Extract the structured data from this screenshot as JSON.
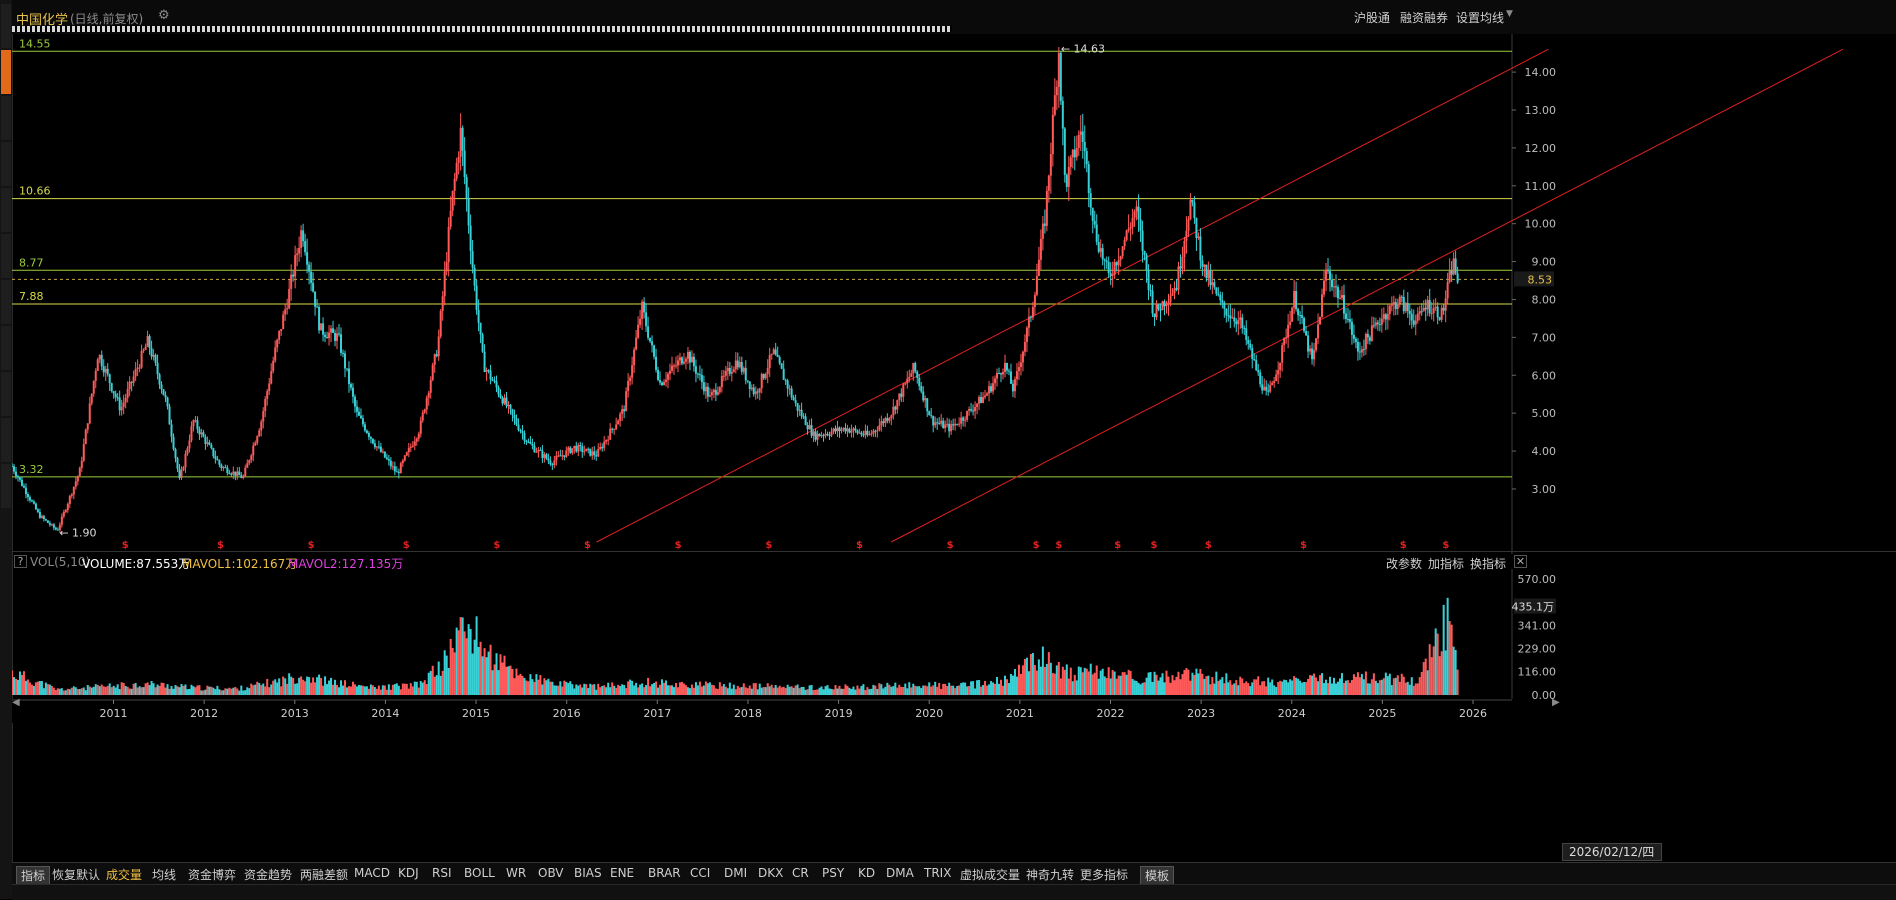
{
  "header": {
    "title": "中国化学",
    "subtitle": "(日线,前复权)",
    "menu": [
      "沪股通",
      "融资融券",
      "设置均线"
    ]
  },
  "volume_panel": {
    "label": "VOL(5,10)",
    "volume": "VOLUME:87.553万",
    "mavol1": "MAVOL1:102.167万",
    "mavol2": "MAVOL2:127.135万",
    "buttons": [
      "改参数",
      "加指标",
      "换指标"
    ],
    "current_label": "435.1万"
  },
  "date_box": "2026/02/12/四",
  "bottom_tabs": [
    "指标",
    "恢复默认",
    "成交量",
    "均线",
    "资金博弈",
    "资金趋势",
    "两融差额",
    "MACD",
    "KDJ",
    "RSI",
    "BOLL",
    "WR",
    "OBV",
    "BIAS",
    "ENE",
    "BRAR",
    "CCI",
    "DMI",
    "DKX",
    "CR",
    "PSY",
    "KD",
    "DMA",
    "TRIX",
    "虚拟成交量",
    "神奇九转",
    "更多指标",
    "模板"
  ],
  "colors": {
    "up": "#ff5a5a",
    "down": "#39d0d6",
    "hline_green": "#9ccc3a",
    "hline_yellow": "#d8d84a",
    "trend": "#e02020",
    "price_tag": "#e8c04a",
    "mavol1": "#f0c040",
    "mavol2": "#e040e0"
  },
  "chart_data": [
    {
      "type": "candlestick",
      "title": "中国化学",
      "ylim": [
        1.6,
        14.9
      ],
      "y_ticks": [
        "14.00",
        "13.00",
        "12.00",
        "11.00",
        "10.00",
        "9.00",
        "8.00",
        "7.00",
        "6.00",
        "5.00",
        "4.00",
        "3.00"
      ],
      "x_ticks": [
        "2011",
        "2012",
        "2013",
        "2014",
        "2015",
        "2016",
        "2017",
        "2018",
        "2019",
        "2020",
        "2021",
        "2022",
        "2023",
        "2024",
        "2025",
        "2026"
      ],
      "current_price": "8.53",
      "max_label": "14.63",
      "min_label": "1.90",
      "horizontal_lines": [
        {
          "label": "14.55",
          "value": 14.55,
          "color": "green"
        },
        {
          "label": "10.66",
          "value": 10.66,
          "color": "yellow"
        },
        {
          "label": "8.77",
          "value": 8.77,
          "color": "green"
        },
        {
          "label": "7.88",
          "value": 7.88,
          "color": "yellow"
        },
        {
          "label": "3.32",
          "value": 3.32,
          "color": "green"
        }
      ],
      "trend_lines": [
        {
          "from": [
            2016.45,
            1.6
          ],
          "to": [
            2026.95,
            14.6
          ]
        },
        {
          "from": [
            2019.7,
            1.6
          ],
          "to": [
            2030.2,
            14.6
          ]
        }
      ],
      "price_path": [
        [
          2010.0,
          3.6
        ],
        [
          2010.3,
          2.3
        ],
        [
          2010.5,
          1.9
        ],
        [
          2010.75,
          3.5
        ],
        [
          2010.95,
          6.6
        ],
        [
          2011.2,
          5.1
        ],
        [
          2011.5,
          6.9
        ],
        [
          2011.7,
          5.3
        ],
        [
          2011.85,
          3.2
        ],
        [
          2012.0,
          4.8
        ],
        [
          2012.3,
          3.6
        ],
        [
          2012.55,
          3.3
        ],
        [
          2012.75,
          4.8
        ],
        [
          2012.9,
          6.6
        ],
        [
          2013.05,
          8.1
        ],
        [
          2013.2,
          9.9
        ],
        [
          2013.4,
          7.2
        ],
        [
          2013.6,
          7.0
        ],
        [
          2013.8,
          5.0
        ],
        [
          2014.0,
          4.2
        ],
        [
          2014.25,
          3.4
        ],
        [
          2014.5,
          4.6
        ],
        [
          2014.7,
          6.8
        ],
        [
          2014.85,
          10.5
        ],
        [
          2014.95,
          12.4
        ],
        [
          2015.1,
          8.4
        ],
        [
          2015.2,
          6.3
        ],
        [
          2015.5,
          5.0
        ],
        [
          2015.7,
          4.2
        ],
        [
          2015.95,
          3.7
        ],
        [
          2016.2,
          4.1
        ],
        [
          2016.45,
          3.9
        ],
        [
          2016.75,
          5.1
        ],
        [
          2016.95,
          7.8
        ],
        [
          2017.15,
          5.8
        ],
        [
          2017.45,
          6.6
        ],
        [
          2017.7,
          5.4
        ],
        [
          2018.0,
          6.4
        ],
        [
          2018.2,
          5.5
        ],
        [
          2018.4,
          6.6
        ],
        [
          2018.65,
          5.2
        ],
        [
          2018.85,
          4.4
        ],
        [
          2019.2,
          4.6
        ],
        [
          2019.45,
          4.4
        ],
        [
          2019.7,
          5.0
        ],
        [
          2019.95,
          6.2
        ],
        [
          2020.15,
          4.8
        ],
        [
          2020.35,
          4.6
        ],
        [
          2020.5,
          4.9
        ],
        [
          2020.75,
          5.5
        ],
        [
          2020.95,
          6.3
        ],
        [
          2021.05,
          5.6
        ],
        [
          2021.25,
          7.7
        ],
        [
          2021.4,
          10.2
        ],
        [
          2021.55,
          14.6
        ],
        [
          2021.62,
          11.0
        ],
        [
          2021.8,
          12.5
        ],
        [
          2021.95,
          9.8
        ],
        [
          2022.1,
          8.6
        ],
        [
          2022.25,
          9.4
        ],
        [
          2022.4,
          10.4
        ],
        [
          2022.6,
          7.6
        ],
        [
          2022.85,
          8.4
        ],
        [
          2023.0,
          10.6
        ],
        [
          2023.15,
          8.8
        ],
        [
          2023.35,
          7.8
        ],
        [
          2023.55,
          7.4
        ],
        [
          2023.75,
          6.0
        ],
        [
          2023.85,
          5.4
        ],
        [
          2024.0,
          6.5
        ],
        [
          2024.15,
          8.1
        ],
        [
          2024.35,
          6.3
        ],
        [
          2024.5,
          8.8
        ],
        [
          2024.7,
          7.8
        ],
        [
          2024.85,
          6.6
        ],
        [
          2025.1,
          7.5
        ],
        [
          2025.3,
          8.0
        ],
        [
          2025.5,
          7.4
        ],
        [
          2025.6,
          7.9
        ],
        [
          2025.78,
          7.6
        ],
        [
          2025.9,
          9.0
        ],
        [
          2025.95,
          8.53
        ]
      ],
      "signal_marks": [
        2011.25,
        2012.3,
        2013.3,
        2014.35,
        2015.35,
        2016.35,
        2017.35,
        2018.35,
        2019.35,
        2020.35,
        2021.3,
        2021.55,
        2022.2,
        2022.6,
        2023.2,
        2024.25,
        2025.35,
        2025.82
      ]
    },
    {
      "type": "bar",
      "title": "VOL(5,10)",
      "ylim": [
        0,
        610
      ],
      "y_ticks": [
        "570.00",
        "341.00",
        "229.00",
        "116.00",
        "0.00"
      ],
      "unit": "万",
      "x": [
        2010.0,
        2010.5,
        2011.0,
        2011.5,
        2012.0,
        2012.5,
        2013.0,
        2013.2,
        2013.5,
        2014.0,
        2014.5,
        2014.8,
        2014.9,
        2015.05,
        2015.3,
        2015.6,
        2016.0,
        2016.5,
        2017.0,
        2017.5,
        2018.0,
        2018.5,
        2019.0,
        2019.5,
        2020.0,
        2020.5,
        2021.0,
        2021.3,
        2021.5,
        2021.7,
        2022.0,
        2022.5,
        2023.0,
        2023.5,
        2024.0,
        2024.5,
        2025.0,
        2025.5,
        2025.85,
        2025.95
      ],
      "values": [
        120,
        30,
        45,
        60,
        40,
        35,
        80,
        110,
        70,
        40,
        55,
        190,
        330,
        360,
        200,
        110,
        60,
        45,
        70,
        55,
        50,
        45,
        40,
        45,
        55,
        50,
        80,
        210,
        170,
        110,
        130,
        90,
        110,
        80,
        70,
        90,
        95,
        80,
        420,
        130
      ]
    }
  ]
}
